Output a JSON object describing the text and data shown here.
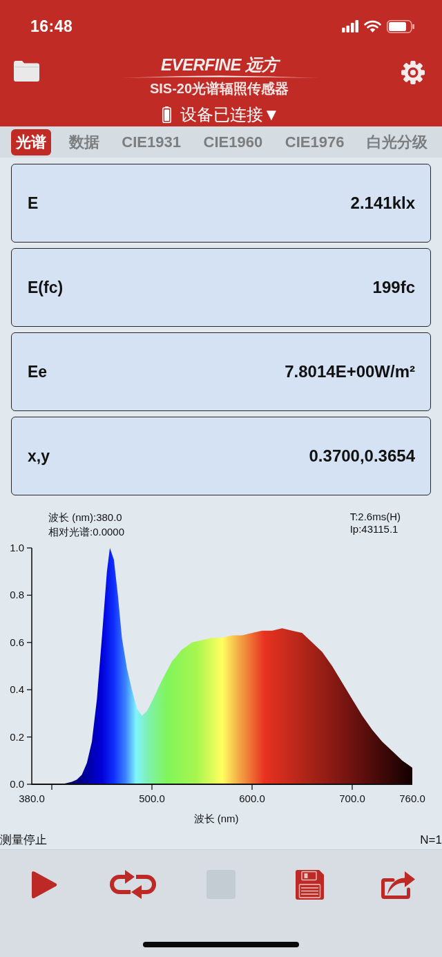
{
  "status_bar": {
    "time": "16:48"
  },
  "header": {
    "logo": "EVERFINE 远方",
    "title": "SIS-20光谱辐照传感器",
    "device_status": "设备已连接▼"
  },
  "tabs": [
    {
      "label": "光谱",
      "selected": true
    },
    {
      "label": "数据",
      "selected": false
    },
    {
      "label": "CIE1931",
      "selected": false
    },
    {
      "label": "CIE1960",
      "selected": false
    },
    {
      "label": "CIE1976",
      "selected": false
    },
    {
      "label": "白光分级",
      "selected": false
    }
  ],
  "readings": [
    {
      "label": "E",
      "value": "2.141klx"
    },
    {
      "label": "E(fc)",
      "value": "199fc"
    },
    {
      "label": "Ee",
      "value": "7.8014E+00W/m²"
    },
    {
      "label": "x,y",
      "value": "0.3700,0.3654"
    }
  ],
  "spectrum": {
    "cursor_readout": [
      "波长 (nm):380.0",
      "相对光谱:0.0000"
    ],
    "acquisition_info": [
      "T:2.6ms(H)",
      "Ip:43115.1"
    ],
    "chart_data": {
      "type": "area",
      "xlabel": "波长 (nm)",
      "x": [
        380,
        390,
        400,
        410,
        420,
        425,
        430,
        435,
        440,
        445,
        450,
        455,
        458,
        462,
        466,
        470,
        475,
        480,
        485,
        490,
        495,
        500,
        510,
        520,
        530,
        540,
        550,
        560,
        570,
        580,
        590,
        600,
        610,
        620,
        630,
        640,
        650,
        660,
        670,
        680,
        690,
        700,
        710,
        720,
        730,
        740,
        750,
        760
      ],
      "values": [
        0,
        0,
        0,
        0,
        0.01,
        0.02,
        0.04,
        0.09,
        0.18,
        0.36,
        0.62,
        0.9,
        1.0,
        0.95,
        0.8,
        0.62,
        0.49,
        0.4,
        0.32,
        0.29,
        0.31,
        0.35,
        0.44,
        0.52,
        0.57,
        0.6,
        0.61,
        0.62,
        0.62,
        0.63,
        0.63,
        0.64,
        0.65,
        0.65,
        0.66,
        0.65,
        0.64,
        0.6,
        0.56,
        0.5,
        0.43,
        0.36,
        0.29,
        0.23,
        0.18,
        0.14,
        0.1,
        0.07
      ],
      "xlim": [
        380,
        760
      ],
      "ylim": [
        0,
        1
      ],
      "xticks": [
        {
          "value": 380,
          "label": "380.0"
        },
        {
          "value": 500,
          "label": "500.0"
        },
        {
          "value": 600,
          "label": "600.0"
        },
        {
          "value": 700,
          "label": "700.0"
        },
        {
          "value": 760,
          "label": "760.0"
        }
      ],
      "yticks": [
        {
          "value": 0,
          "label": "0.0"
        },
        {
          "value": 0.2,
          "label": "0.2"
        },
        {
          "value": 0.4,
          "label": "0.4"
        },
        {
          "value": 0.6,
          "label": "0.6"
        },
        {
          "value": 0.8,
          "label": "0.8"
        },
        {
          "value": 1,
          "label": "1.0"
        }
      ]
    }
  },
  "measurement": {
    "state": "测量停止",
    "count": "N=1"
  },
  "toolbar": [
    {
      "kind": "play",
      "disabled": false
    },
    {
      "kind": "loop",
      "disabled": false
    },
    {
      "kind": "stop",
      "disabled": true
    },
    {
      "kind": "save",
      "disabled": false
    },
    {
      "kind": "share",
      "disabled": false
    }
  ]
}
